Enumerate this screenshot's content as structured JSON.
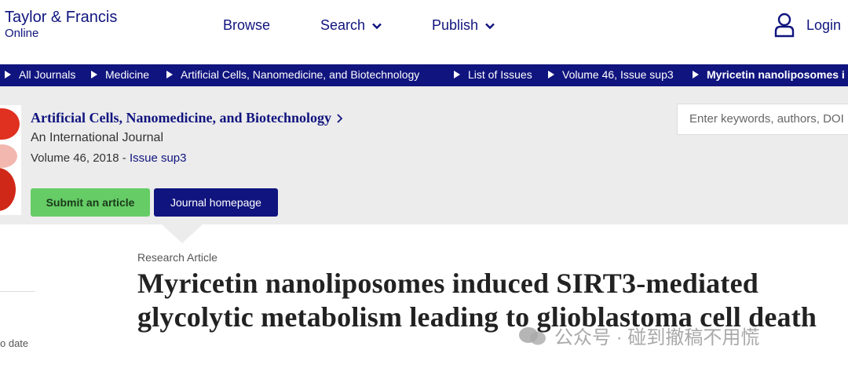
{
  "header": {
    "logo_line1": "Taylor & Francis",
    "logo_line2": "Online",
    "nav": {
      "browse": "Browse",
      "search": "Search",
      "publish": "Publish"
    },
    "login": "Login"
  },
  "breadcrumb": [
    "All Journals",
    "Medicine",
    "Artificial Cells, Nanomedicine, and Biotechnology",
    "List of Issues",
    "Volume 46, Issue sup3",
    "Myricetin nanoliposomes i"
  ],
  "journal": {
    "title": "Artificial Cells, Nanomedicine, and Biotechnology",
    "subtitle": "An International Journal",
    "volume": "Volume 46, 2018 -",
    "issue": "Issue sup3",
    "submit_label": "Submit an article",
    "homepage_label": "Journal homepage",
    "search_placeholder": "Enter keywords, authors, DOI"
  },
  "article": {
    "type": "Research Article",
    "title": "Myricetin nanoliposomes induced SIRT3-mediated glycolytic metabolism leading to glioblastoma cell death",
    "sidebar_text": "o date"
  },
  "watermark": {
    "text": "公众号 · 碰到撤稿不用慌"
  },
  "colors": {
    "brand_navy": "#10147e",
    "submit_green": "#66cc66",
    "band_gray": "#ececec"
  }
}
